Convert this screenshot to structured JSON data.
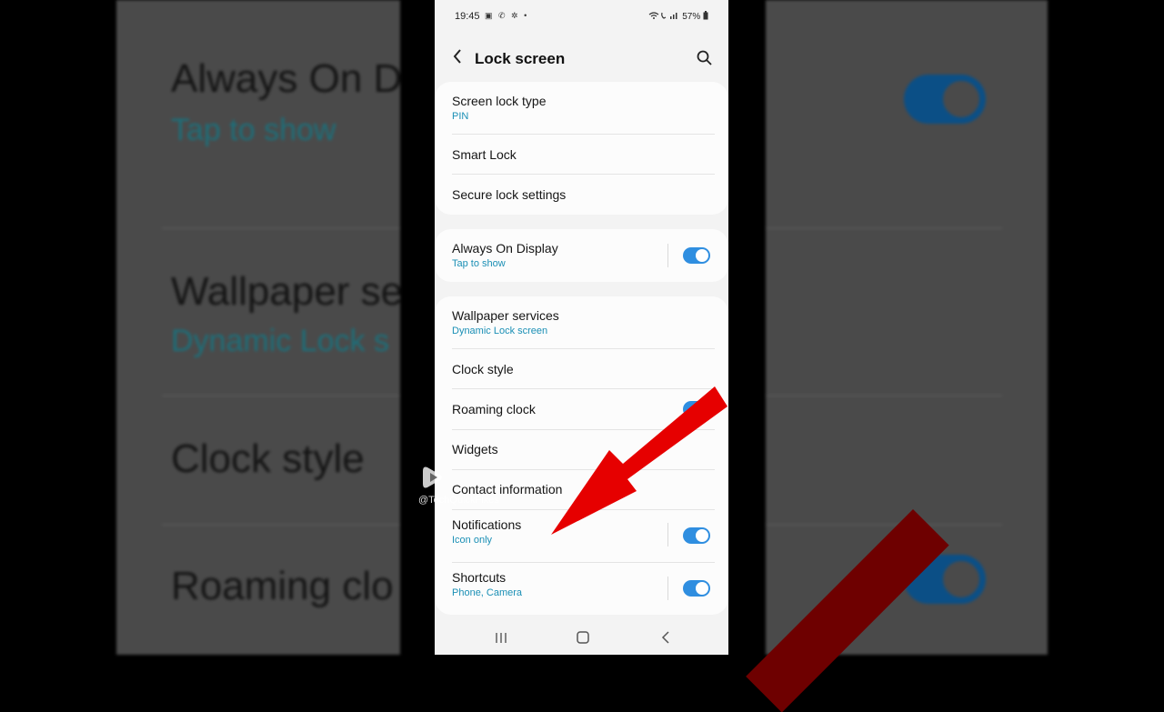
{
  "status_bar": {
    "time": "19:45",
    "left_icons": "▣ ✆ ✲ •",
    "battery": "57%"
  },
  "header": {
    "title": "Lock screen"
  },
  "sections": [
    {
      "items": [
        {
          "label": "Screen lock type",
          "sub": "PIN"
        },
        {
          "label": "Smart Lock",
          "sub": ""
        },
        {
          "label": "Secure lock settings",
          "sub": ""
        }
      ]
    },
    {
      "items": [
        {
          "label": "Always On Display",
          "sub": "Tap to show",
          "toggle": true
        }
      ]
    },
    {
      "items": [
        {
          "label": "Wallpaper services",
          "sub": "Dynamic Lock screen"
        },
        {
          "label": "Clock style",
          "sub": ""
        },
        {
          "label": "Roaming clock",
          "sub": "",
          "toggle": true
        },
        {
          "label": "Widgets",
          "sub": ""
        },
        {
          "label": "Contact information",
          "sub": ""
        },
        {
          "label": "Notifications",
          "sub": "Icon only",
          "toggle": true
        },
        {
          "label": "Shortcuts",
          "sub": "Phone, Camera",
          "toggle": true
        }
      ]
    }
  ],
  "background": {
    "left_texts": [
      "Always On D",
      "Tap to show",
      "Wallpaper se",
      "Dynamic Lock s",
      "Clock style",
      "Roaming clo"
    ]
  },
  "watermark": {
    "handle": "@TechQuickFixes"
  },
  "colors": {
    "accent": "#2f8ee0",
    "subtext": "#1a8fb5",
    "arrow": "#e60000"
  },
  "navbar": {
    "icons": [
      "recent-apps-icon",
      "home-icon",
      "back-icon"
    ]
  }
}
